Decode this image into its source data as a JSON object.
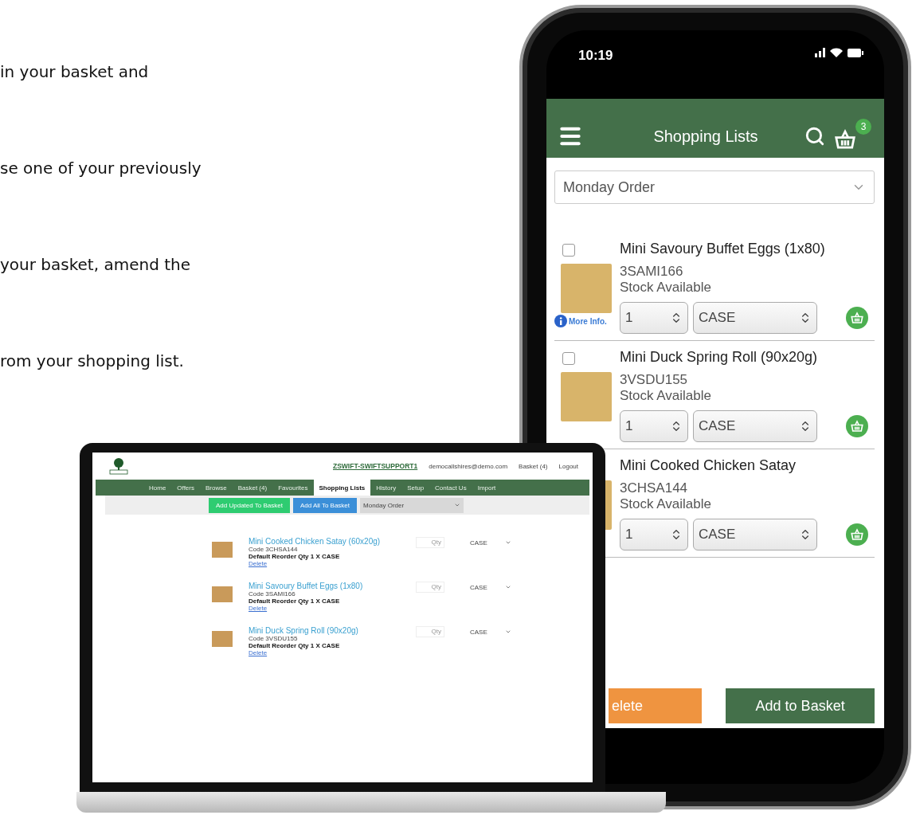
{
  "intro_lines": [
    "in your basket and",
    "se one of your previously",
    "your basket, amend the",
    "rom your shopping list."
  ],
  "laptop": {
    "header": {
      "account_link": "ZSWIFT-SWIFTSUPPORT1",
      "email": "democallshires@demo.com",
      "basket_link": "Basket (4)",
      "logout_link": "Logout"
    },
    "nav": [
      {
        "label": "Home",
        "selected": false
      },
      {
        "label": "Offers",
        "selected": false
      },
      {
        "label": "Browse",
        "selected": false
      },
      {
        "label": "Basket (4)",
        "selected": false
      },
      {
        "label": "Favourites",
        "selected": false
      },
      {
        "label": "Shopping Lists",
        "selected": true
      },
      {
        "label": "History",
        "selected": false
      },
      {
        "label": "Setup",
        "selected": false
      },
      {
        "label": "Contact Us",
        "selected": false
      },
      {
        "label": "Import",
        "selected": false
      }
    ],
    "toolbar": {
      "buttons": [
        {
          "label": "Add Updated To Basket",
          "kind": "update"
        },
        {
          "label": "Add All To Basket",
          "kind": "all"
        }
      ],
      "list_select": "Monday Order"
    },
    "items": [
      {
        "name": "Mini Cooked Chicken Satay (60x20g)",
        "code": "Code 3CHSA144",
        "reorder": "Default Reorder Qty 1 X CASE",
        "delete": "Delete",
        "qty_placeholder": "Qty",
        "unit": "CASE"
      },
      {
        "name": "Mini Savoury Buffet Eggs (1x80)",
        "code": "Code 3SAMI166",
        "reorder": "Default Reorder Qty 1 X CASE",
        "delete": "Delete",
        "qty_placeholder": "Qty",
        "unit": "CASE"
      },
      {
        "name": "Mini Duck Spring Roll (90x20g)",
        "code": "Code 3VSDU155",
        "reorder": "Default Reorder Qty 1 X CASE",
        "delete": "Delete",
        "qty_placeholder": "Qty",
        "unit": "CASE"
      }
    ]
  },
  "phone": {
    "time": "10:19",
    "title": "Shopping Lists",
    "basket_count": "3",
    "list_select": "Monday Order",
    "items": [
      {
        "name": "Mini Savoury Buffet Eggs (1x80)",
        "code": "3SAMI166",
        "stock": "Stock Available",
        "qty": "1",
        "unit": "CASE",
        "checked": false,
        "more_info": "More Info."
      },
      {
        "name": "Mini Duck Spring Roll (90x20g)",
        "code": "3VSDU155",
        "stock": "Stock Available",
        "qty": "1",
        "unit": "CASE",
        "checked": false
      },
      {
        "name": "Mini Cooked Chicken Satay",
        "code": "3CHSA144",
        "stock": "Stock Available",
        "qty": "1",
        "unit": "CASE"
      }
    ],
    "buttons": [
      {
        "label": "elete",
        "kind": "delete"
      },
      {
        "label": "Add to Basket",
        "kind": "add"
      }
    ]
  }
}
